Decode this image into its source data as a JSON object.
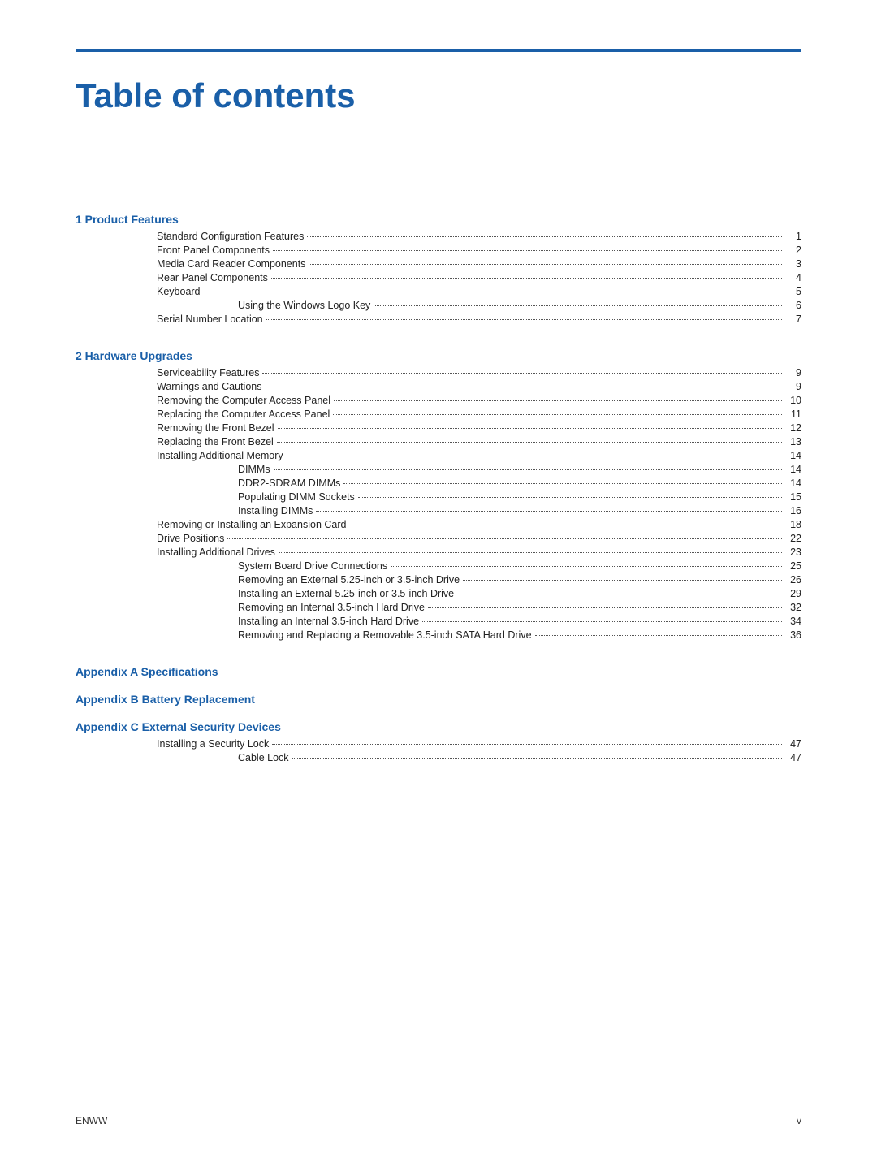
{
  "page": {
    "title": "Table of contents",
    "footer_left": "ENWW",
    "footer_right": "v"
  },
  "sections": [
    {
      "id": "section1",
      "heading": "1  Product Features",
      "entries": [
        {
          "id": "e1",
          "indent": 1,
          "title": "Standard Configuration Features",
          "page": "1"
        },
        {
          "id": "e2",
          "indent": 1,
          "title": "Front Panel Components",
          "page": "2"
        },
        {
          "id": "e3",
          "indent": 1,
          "title": "Media Card Reader Components",
          "page": "3"
        },
        {
          "id": "e4",
          "indent": 1,
          "title": "Rear Panel Components",
          "page": "4"
        },
        {
          "id": "e5",
          "indent": 1,
          "title": "Keyboard",
          "page": "5"
        },
        {
          "id": "e6",
          "indent": 2,
          "title": "Using the Windows Logo Key",
          "page": "6"
        },
        {
          "id": "e7",
          "indent": 1,
          "title": "Serial Number Location",
          "page": "7"
        }
      ]
    },
    {
      "id": "section2",
      "heading": "2  Hardware Upgrades",
      "entries": [
        {
          "id": "e8",
          "indent": 1,
          "title": "Serviceability Features",
          "page": "9"
        },
        {
          "id": "e9",
          "indent": 1,
          "title": "Warnings and Cautions",
          "page": "9"
        },
        {
          "id": "e10",
          "indent": 1,
          "title": "Removing the Computer Access Panel",
          "page": "10"
        },
        {
          "id": "e11",
          "indent": 1,
          "title": "Replacing the Computer Access Panel",
          "page": "11"
        },
        {
          "id": "e12",
          "indent": 1,
          "title": "Removing the Front Bezel",
          "page": "12"
        },
        {
          "id": "e13",
          "indent": 1,
          "title": "Replacing the Front Bezel",
          "page": "13"
        },
        {
          "id": "e14",
          "indent": 1,
          "title": "Installing Additional Memory",
          "page": "14"
        },
        {
          "id": "e15",
          "indent": 2,
          "title": "DIMMs",
          "page": "14"
        },
        {
          "id": "e16",
          "indent": 2,
          "title": "DDR2-SDRAM DIMMs",
          "page": "14"
        },
        {
          "id": "e17",
          "indent": 2,
          "title": "Populating DIMM Sockets",
          "page": "15"
        },
        {
          "id": "e18",
          "indent": 2,
          "title": "Installing DIMMs",
          "page": "16"
        },
        {
          "id": "e19",
          "indent": 1,
          "title": "Removing or Installing an Expansion Card",
          "page": "18"
        },
        {
          "id": "e20",
          "indent": 1,
          "title": "Drive Positions",
          "page": "22"
        },
        {
          "id": "e21",
          "indent": 1,
          "title": "Installing Additional Drives",
          "page": "23"
        },
        {
          "id": "e22",
          "indent": 2,
          "title": "System Board Drive Connections",
          "page": "25"
        },
        {
          "id": "e23",
          "indent": 2,
          "title": "Removing an External 5.25-inch or 3.5-inch Drive",
          "page": "26"
        },
        {
          "id": "e24",
          "indent": 2,
          "title": "Installing an External 5.25-inch or 3.5-inch Drive",
          "page": "29"
        },
        {
          "id": "e25",
          "indent": 2,
          "title": "Removing an Internal 3.5-inch Hard Drive",
          "page": "32"
        },
        {
          "id": "e26",
          "indent": 2,
          "title": "Installing an Internal 3.5-inch Hard Drive",
          "page": "34"
        },
        {
          "id": "e27",
          "indent": 2,
          "title": "Removing and Replacing a Removable 3.5-inch SATA Hard Drive",
          "page": "36"
        }
      ]
    }
  ],
  "appendices": [
    {
      "id": "appA",
      "heading": "Appendix A  Specifications",
      "entries": []
    },
    {
      "id": "appB",
      "heading": "Appendix B  Battery Replacement",
      "entries": []
    },
    {
      "id": "appC",
      "heading": "Appendix C  External Security Devices",
      "entries": [
        {
          "id": "ac1",
          "indent": 1,
          "title": "Installing a Security Lock",
          "page": "47"
        },
        {
          "id": "ac2",
          "indent": 2,
          "title": "Cable Lock",
          "page": "47"
        }
      ]
    }
  ]
}
